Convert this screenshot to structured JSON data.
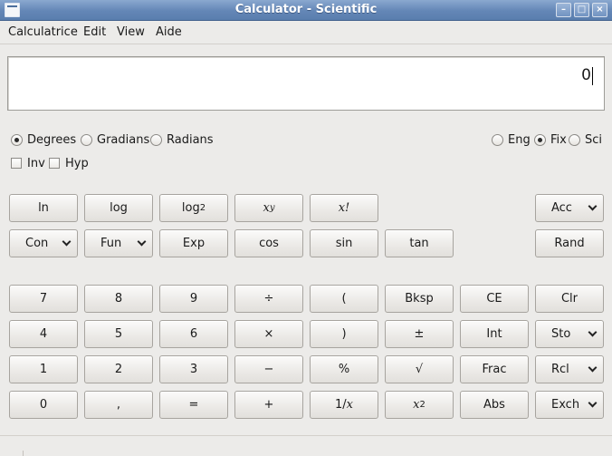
{
  "window": {
    "title": "Calculator - Scientific"
  },
  "menu": {
    "calc": "Calculatrice",
    "edit": "Edit",
    "view": "View",
    "help": "Aide"
  },
  "display": {
    "value": "0"
  },
  "angle": {
    "degrees": "Degrees",
    "gradians": "Gradians",
    "radians": "Radians",
    "selected": "Degrees"
  },
  "notation": {
    "eng": "Eng",
    "fix": "Fix",
    "sci": "Sci",
    "selected": "Fix"
  },
  "modifiers": {
    "inv": "Inv",
    "hyp": "Hyp"
  },
  "buttons": {
    "ln": "ln",
    "log": "log",
    "log2_base": "log",
    "log2_sub": "2",
    "xy_base": "x",
    "xy_sup": "y",
    "fact": "x!",
    "acc": "Acc",
    "con": "Con",
    "fun": "Fun",
    "exp": "Exp",
    "cos": "cos",
    "sin": "sin",
    "tan": "tan",
    "rand": "Rand",
    "n7": "7",
    "n8": "8",
    "n9": "9",
    "div": "÷",
    "lparen": "(",
    "bksp": "Bksp",
    "ce": "CE",
    "clr": "Clr",
    "n4": "4",
    "n5": "5",
    "n6": "6",
    "mul": "×",
    "rparen": ")",
    "plusminus": "±",
    "int": "Int",
    "sto": "Sto",
    "n1": "1",
    "n2": "2",
    "n3": "3",
    "minus": "−",
    "percent": "%",
    "sqrt": "√",
    "frac": "Frac",
    "rcl": "Rcl",
    "n0": "0",
    "comma": ",",
    "equals": "=",
    "plus": "+",
    "recip_a": "1/",
    "recip_b": "x",
    "sq_base": "x",
    "sq_sup": "2",
    "abs": "Abs",
    "exch": "Exch"
  }
}
